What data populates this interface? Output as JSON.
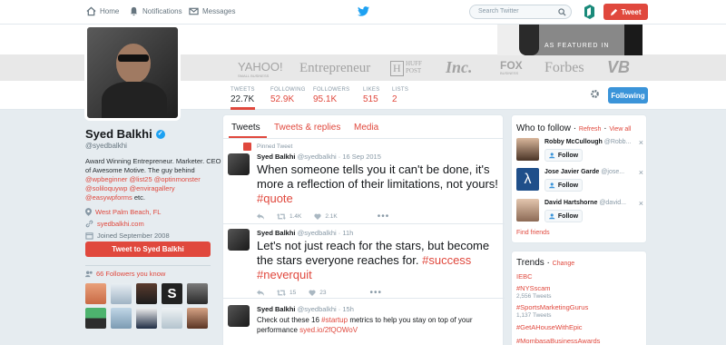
{
  "nav": {
    "home": "Home",
    "notifications": "Notifications",
    "messages": "Messages",
    "search_placeholder": "Search Twitter",
    "tweet_button": "Tweet"
  },
  "banner": {
    "featured_label": "AS FEATURED IN",
    "logos": [
      "YAHOO!",
      "SMALL BUSINESS",
      "Entrepreneur",
      "H",
      "HUFF",
      "POST",
      "Inc.",
      "FOX",
      "BUSINESS",
      "Forbes",
      "VB"
    ]
  },
  "stats": [
    {
      "label": "TWEETS",
      "value": "22.7K"
    },
    {
      "label": "FOLLOWING",
      "value": "52.9K"
    },
    {
      "label": "FOLLOWERS",
      "value": "95.1K"
    },
    {
      "label": "LIKES",
      "value": "515"
    },
    {
      "label": "LISTS",
      "value": "2"
    }
  ],
  "follow_button": "Following",
  "profile": {
    "name": "Syed Balkhi",
    "handle": "@syedbalkhi",
    "bio_text": "Award Winning Entrepreneur. Marketer. CEO of Awesome Motive. The guy behind",
    "bio_links": [
      "@wpbeginner",
      "@list25",
      "@optinmonster",
      "@soliloquywp",
      "@enviragallery",
      "@easywpforms"
    ],
    "bio_end": "etc.",
    "location": "West Palm Beach, FL",
    "website": "syedbalkhi.com",
    "joined": "Joined September 2008",
    "tweet_to": "Tweet to Syed Balkhi",
    "followers_you_know": "66 Followers you know"
  },
  "tabs": [
    "Tweets",
    "Tweets & replies",
    "Media"
  ],
  "tweets": [
    {
      "pinned": "Pinned Tweet",
      "name": "Syed Balkhi",
      "handle": "@syedbalkhi",
      "time": "16 Sep 2015",
      "text": "When someone tells you it can't be done, it's more a reflection of their limitations, not yours!",
      "hashtag": "#quote",
      "retweets": "1.4K",
      "likes": "2.1K"
    },
    {
      "name": "Syed Balkhi",
      "handle": "@syedbalkhi",
      "time": "11h",
      "text": "Let's not just reach for the stars, but become the stars everyone reaches for.",
      "hashtags": "#success #neverquit",
      "retweets": "15",
      "likes": "23"
    },
    {
      "name": "Syed Balkhi",
      "handle": "@syedbalkhi",
      "time": "15h",
      "text_a": "Check out these 16",
      "hashtag": "#startup",
      "text_b": "metrics to help you stay on top of your performance",
      "link": "syed.io/2fQOWoV"
    }
  ],
  "who_to_follow": {
    "title": "Who to follow",
    "refresh": "Refresh",
    "view_all": "View all",
    "users": [
      {
        "name": "Robby McCullough",
        "handle": "@Robb..."
      },
      {
        "name": "Jose Javier Garde",
        "handle": "@jose..."
      },
      {
        "name": "David Hartshorne",
        "handle": "@david..."
      }
    ],
    "follow": "Follow",
    "find_friends": "Find friends"
  },
  "trends": {
    "title": "Trends",
    "change": "Change",
    "items": [
      {
        "name": "IEBC",
        "count": ""
      },
      {
        "name": "#NYSscam",
        "count": "2,556 Tweets"
      },
      {
        "name": "#SportsMarketingGurus",
        "count": "1,137 Tweets"
      },
      {
        "name": "#GetAHouseWithEpic",
        "count": ""
      },
      {
        "name": "#MombasaBusinessAwards",
        "count": ""
      }
    ]
  },
  "colors": {
    "accent": "#e0483d",
    "follow_blue": "#3b94d9",
    "bg": "#e6ecf0"
  }
}
